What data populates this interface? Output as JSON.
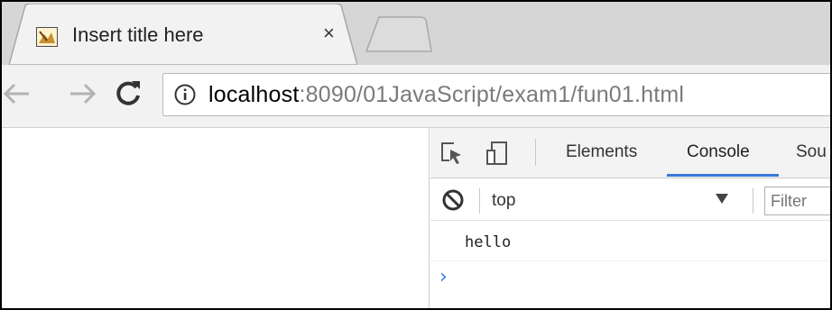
{
  "tab": {
    "title": "Insert title here",
    "close_glyph": "×",
    "favicon": "page-favicon-icon"
  },
  "toolbar": {
    "back_icon": "arrow-left-icon",
    "forward_icon": "arrow-right-icon",
    "reload_icon": "reload-icon",
    "url_host": "localhost",
    "url_rest": ":8090/01JavaScript/exam1/fun01.html"
  },
  "devtools": {
    "tabs": [
      "Elements",
      "Console",
      "Sou"
    ],
    "active_tab": "Console",
    "context_value": "top",
    "filter_placeholder": "Filter",
    "messages": [
      "hello"
    ],
    "prompt_glyph": "›"
  },
  "colors": {
    "accent": "#3879d9",
    "prompt": "#367cf1"
  }
}
